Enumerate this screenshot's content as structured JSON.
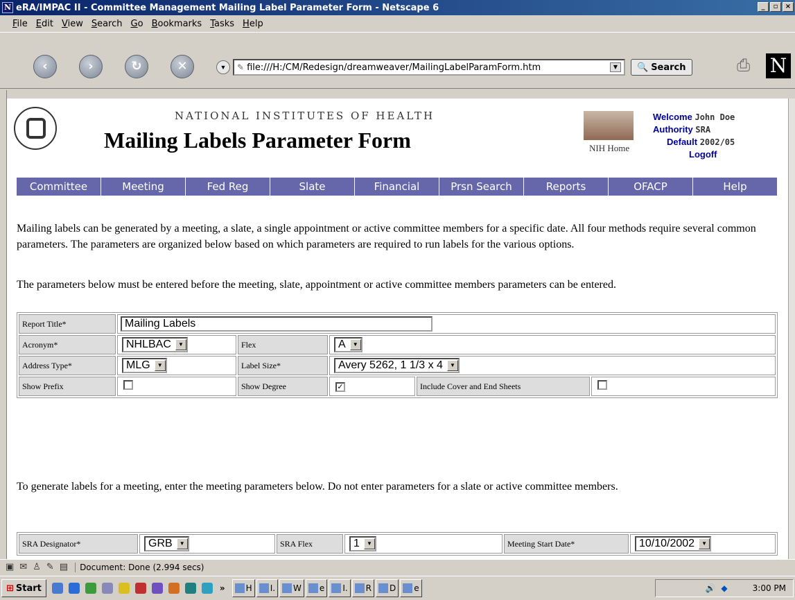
{
  "window": {
    "title": "eRA/IMPAC II - Committee Management Mailing Label Parameter Form - Netscape 6"
  },
  "menu": [
    {
      "label": "File",
      "key": "F",
      "rest": "ile"
    },
    {
      "label": "Edit",
      "key": "E",
      "rest": "dit"
    },
    {
      "label": "View",
      "key": "V",
      "rest": "iew"
    },
    {
      "label": "Search",
      "key": "S",
      "rest": "earch"
    },
    {
      "label": "Go",
      "key": "G",
      "rest": "o"
    },
    {
      "label": "Bookmarks",
      "key": "B",
      "rest": "ookmarks"
    },
    {
      "label": "Tasks",
      "key": "T",
      "rest": "asks"
    },
    {
      "label": "Help",
      "key": "H",
      "rest": "elp"
    }
  ],
  "toolbar": {
    "url": "file:///H:/CM/Redesign/dreamweaver/MailingLabelParamForm.htm",
    "search_label": "Search"
  },
  "page": {
    "org": "NATIONAL INSTITUTES OF HEALTH",
    "title": "Mailing Labels Parameter Form",
    "home_label": "NIH Home",
    "welcome_label": "Welcome",
    "user": "John Doe",
    "authority_label": "Authority",
    "authority_value": "SRA",
    "default_label": "Default",
    "default_value": "2002/05",
    "logoff": "Logoff"
  },
  "nav": [
    "Committee",
    "Meeting",
    "Fed Reg",
    "Slate",
    "Financial",
    "Prsn Search",
    "Reports",
    "OFACP",
    "Help"
  ],
  "intro": "Mailing labels can be generated by a meeting, a slate, a single appointment or active committee members for a specific date. All four methods require several common parameters. The parameters are organized below based on which parameters are required to run labels for the various options.",
  "intro2": "The parameters below must be entered before the meeting, slate, appointment or active committee members parameters can be entered.",
  "form": {
    "report_title_label": "Report Title*",
    "report_title_value": "Mailing Labels",
    "acronym_label": "Acronym*",
    "acronym_value": "NHLBAC",
    "flex_label": "Flex",
    "flex_value": "A",
    "address_type_label": "Address Type*",
    "address_type_value": "MLG",
    "label_size_label": "Label Size*",
    "label_size_value": "Avery 5262, 1 1/3 x 4",
    "show_prefix_label": "Show Prefix",
    "show_prefix_checked": false,
    "show_degree_label": "Show Degree",
    "show_degree_checked": true,
    "cover_label": "Include Cover and End Sheets",
    "cover_checked": false
  },
  "meeting_text": "To generate labels for a meeting, enter the meeting parameters below. Do not enter parameters for a slate or active committee members.",
  "meeting": {
    "sra_label": "SRA Designator*",
    "sra_value": "GRB",
    "sra_flex_label": "SRA Flex",
    "sra_flex_value": "1",
    "start_label": "Meeting Start Date*",
    "start_value": "10/10/2002"
  },
  "status": {
    "text": "Document: Done (2.994 secs)"
  },
  "taskbar": {
    "start": "Start",
    "tasks": [
      "H",
      "I.",
      "W",
      "e",
      "I.",
      "R",
      "D",
      "e"
    ],
    "clock": "3:00 PM"
  }
}
